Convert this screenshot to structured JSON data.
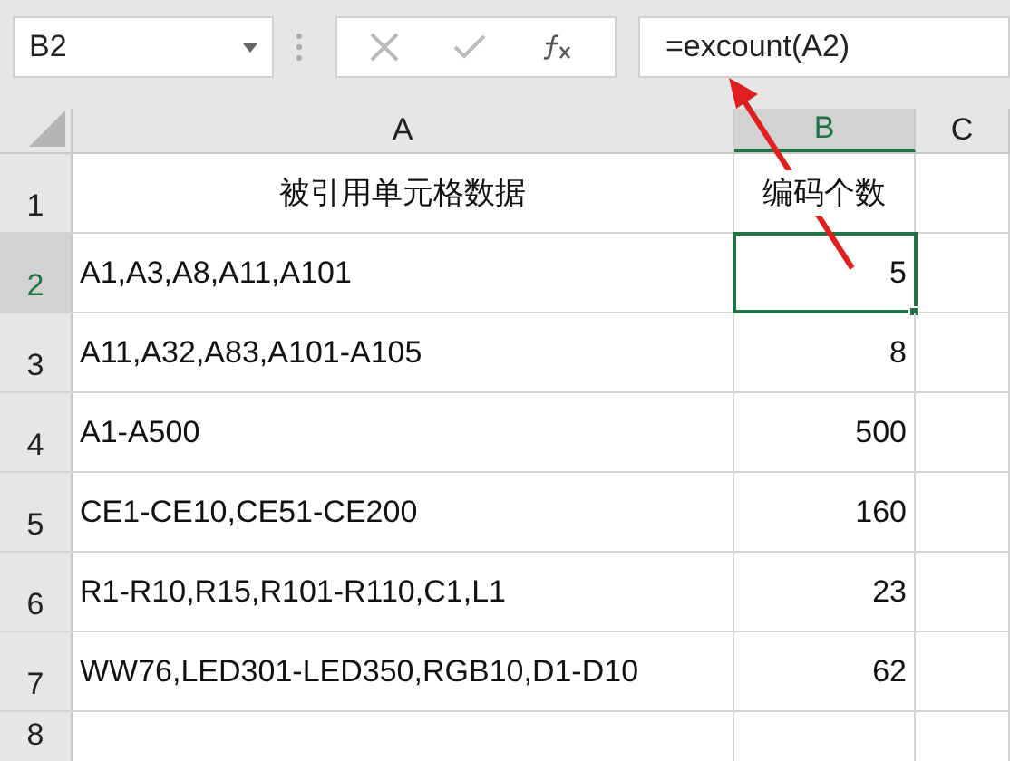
{
  "name_box": {
    "value": "B2"
  },
  "formula_bar": {
    "value": "=excount(A2)"
  },
  "columns": [
    {
      "label": "A",
      "selected": false
    },
    {
      "label": "B",
      "selected": true
    },
    {
      "label": "C",
      "selected": false
    }
  ],
  "rows": [
    {
      "header": "1",
      "selected": false,
      "cells": [
        "被引用单元格数据",
        "编码个数"
      ],
      "kind": "heading"
    },
    {
      "header": "2",
      "selected": true,
      "cells": [
        "A1,A3,A8,A11,A101",
        "5"
      ],
      "kind": "data"
    },
    {
      "header": "3",
      "selected": false,
      "cells": [
        "A11,A32,A83,A101-A105",
        "8"
      ],
      "kind": "data"
    },
    {
      "header": "4",
      "selected": false,
      "cells": [
        "A1-A500",
        "500"
      ],
      "kind": "data"
    },
    {
      "header": "5",
      "selected": false,
      "cells": [
        "CE1-CE10,CE51-CE200",
        "160"
      ],
      "kind": "data"
    },
    {
      "header": "6",
      "selected": false,
      "cells": [
        "R1-R10,R15,R101-R110,C1,L1",
        "23"
      ],
      "kind": "data"
    },
    {
      "header": "7",
      "selected": false,
      "cells": [
        "WW76,LED301-LED350,RGB10,D1-D10",
        "62"
      ],
      "kind": "data"
    },
    {
      "header": "8",
      "selected": false,
      "cells": [],
      "kind": "data"
    }
  ]
}
